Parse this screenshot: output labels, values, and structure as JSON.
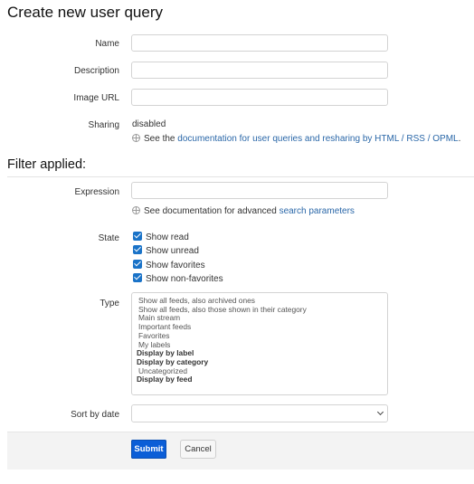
{
  "page": {
    "title": "Create new user query",
    "filter_heading": "Filter applied:"
  },
  "form": {
    "name_label": "Name",
    "description_label": "Description",
    "image_url_label": "Image URL",
    "sharing_label": "Sharing",
    "sharing_value": "disabled",
    "sharing_help_prefix": "See the",
    "sharing_help_link": "documentation for user queries and resharing by HTML / RSS / OPML",
    "sharing_help_suffix": "."
  },
  "filter": {
    "expression_label": "Expression",
    "expression_help_prefix": "See documentation for advanced",
    "expression_help_link": "search parameters",
    "state_label": "State",
    "states": [
      {
        "label": "Show read",
        "checked": true
      },
      {
        "label": "Show unread",
        "checked": true
      },
      {
        "label": "Show favorites",
        "checked": true
      },
      {
        "label": "Show non-favorites",
        "checked": true
      }
    ],
    "type_label": "Type",
    "type_options": [
      "Show all feeds, also archived ones",
      "Show all feeds, also those shown in their category",
      "Main stream",
      "Important feeds",
      "Favorites",
      "My labels",
      "Display by label",
      "Display by category",
      "Uncategorized",
      "Display by feed"
    ],
    "sort_label": "Sort by date",
    "sort_value": ""
  },
  "actions": {
    "submit_label": "Submit",
    "cancel_label": "Cancel"
  },
  "colors": {
    "accent": "#0b5ed7",
    "link": "#2a67a8",
    "checkbox": "#1a73c8"
  }
}
